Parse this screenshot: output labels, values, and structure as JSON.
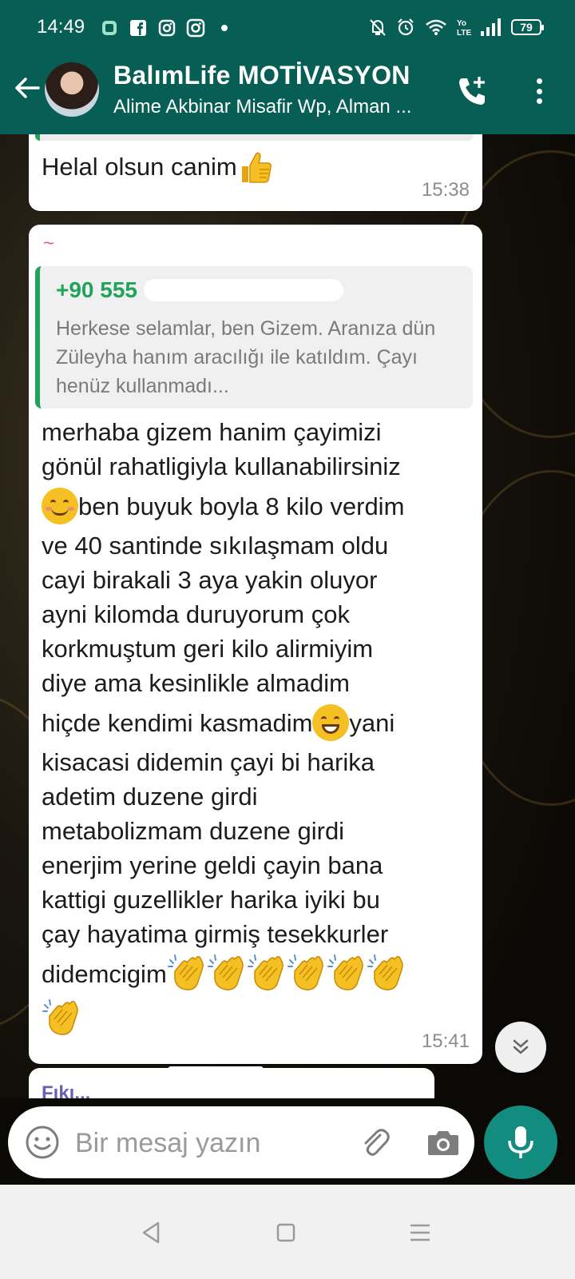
{
  "status_bar": {
    "time": "14:49",
    "battery": "79",
    "notif_icons": [
      "app-icon",
      "facebook-icon",
      "instagram-icon",
      "instagram-icon",
      "dot"
    ],
    "system_icons": [
      "mute-icon",
      "alarm-icon",
      "wifi-icon",
      "volte-icon",
      "signal-icon",
      "battery-icon"
    ]
  },
  "header": {
    "title": "BalımLife MOTİVASYON",
    "subtitle": "Alime Akbinar Misafir Wp, Alman ...",
    "accent_color": "#075e54"
  },
  "messages": [
    {
      "text": "Helal olsun canim",
      "emoji": "thumbs-up",
      "time": "15:38"
    },
    {
      "sender": "~",
      "quoted": {
        "name": "+90 555",
        "text": "Herkese selamlar, ben Gizem. Aranıza dün Züleyha hanım aracılığı ile katıldım. Çayı henüz kullanmadı..."
      },
      "lines": [
        "merhaba gizem hanim çayimizi",
        "gönül rahatligiyla kullanabilirsiniz",
        "ben buyuk boyla 8 kilo verdim",
        "ve 40 santinde sıkılaşmam oldu",
        "cayi birakali 3 aya yakin oluyor",
        "ayni kilomda duruyorum çok",
        "korkmuştum geri kilo alirmiyim",
        "diye ama kesinlikle almadim",
        "hiçde kendimi kasmadim",
        "yani",
        "kisacasi didemin çayi bi harika",
        "adetim duzene girdi",
        "metabolizmam duzene girdi",
        "enerjim yerine geldi çayin bana",
        "kattigi guzellikler harika iyiki bu",
        "çay hayatima girmiş tesekkurler",
        "didemcigim"
      ],
      "time": "15:41"
    },
    {
      "sender": "Fıkı..."
    }
  ],
  "composer": {
    "placeholder": "Bir mesaj yazın"
  }
}
